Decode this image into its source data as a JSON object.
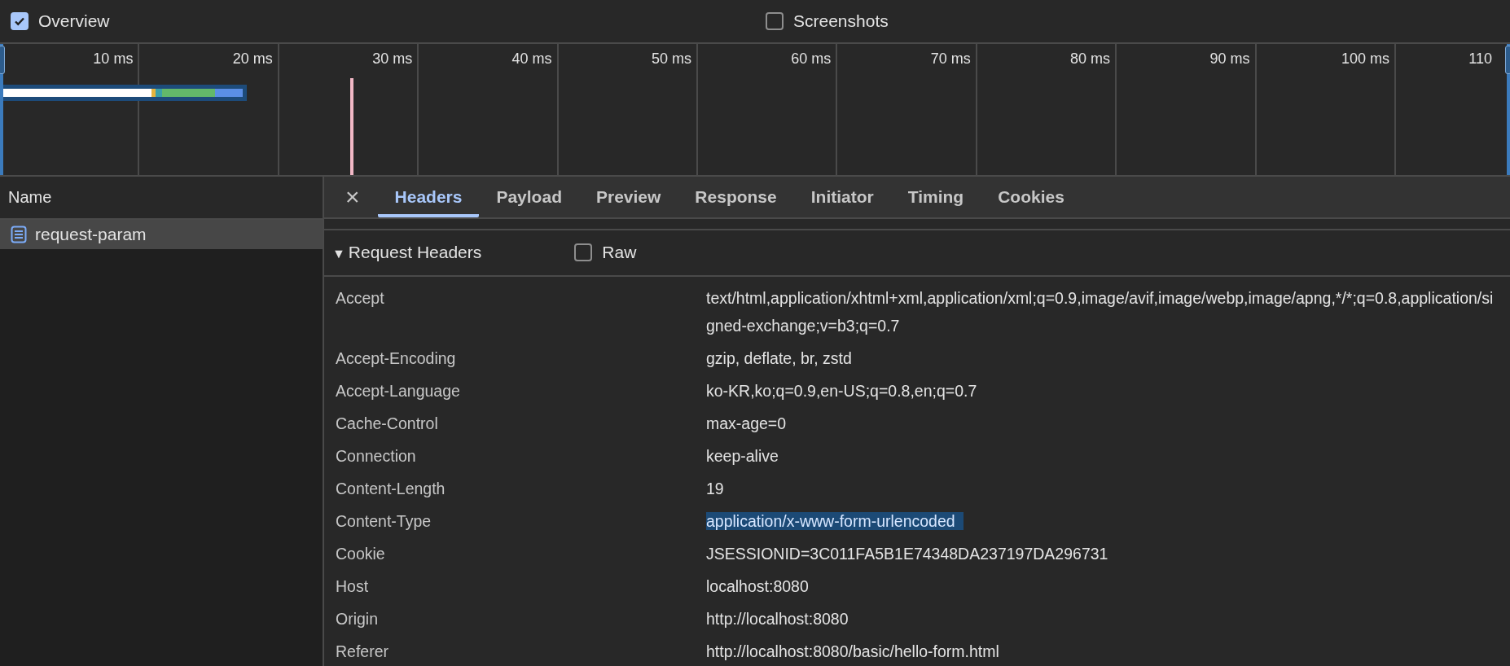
{
  "toolbar": {
    "options": [
      {
        "label": "Overview",
        "checked": true
      },
      {
        "label": "Screenshots",
        "checked": false
      }
    ]
  },
  "timeline": {
    "ticks": [
      "10 ms",
      "20 ms",
      "30 ms",
      "40 ms",
      "50 ms",
      "60 ms",
      "70 ms",
      "80 ms",
      "90 ms",
      "100 ms",
      "110"
    ]
  },
  "requests": {
    "column": "Name",
    "items": [
      {
        "name": "request-param",
        "selected": true
      }
    ]
  },
  "details": {
    "close": "×",
    "tabs": [
      {
        "label": "Headers",
        "selected": true
      },
      {
        "label": "Payload",
        "selected": false
      },
      {
        "label": "Preview",
        "selected": false
      },
      {
        "label": "Response",
        "selected": false
      },
      {
        "label": "Initiator",
        "selected": false
      },
      {
        "label": "Timing",
        "selected": false
      },
      {
        "label": "Cookies",
        "selected": false
      }
    ],
    "section": {
      "toggle": "▼",
      "title": "Request Headers",
      "expanded": true,
      "raw": {
        "label": "Raw",
        "checked": false
      }
    },
    "headers": [
      {
        "name": "Accept",
        "value": "text/html,application/xhtml+xml,application/xml;q=0.9,image/avif,image/webp,image/apng,*/*;q=0.8,application/signed-exchange;v=b3;q=0.7",
        "selected": false
      },
      {
        "name": "Accept-Encoding",
        "value": "gzip, deflate, br, zstd",
        "selected": false
      },
      {
        "name": "Accept-Language",
        "value": "ko-KR,ko;q=0.9,en-US;q=0.8,en;q=0.7",
        "selected": false
      },
      {
        "name": "Cache-Control",
        "value": "max-age=0",
        "selected": false
      },
      {
        "name": "Connection",
        "value": "keep-alive",
        "selected": false
      },
      {
        "name": "Content-Length",
        "value": "19",
        "selected": false
      },
      {
        "name": "Content-Type",
        "value": "application/x-www-form-urlencoded",
        "selected": true
      },
      {
        "name": "Cookie",
        "value": "JSESSIONID=3C011FA5B1E74348DA237197DA296731",
        "selected": false
      },
      {
        "name": "Host",
        "value": "localhost:8080",
        "selected": false
      },
      {
        "name": "Origin",
        "value": "http://localhost:8080",
        "selected": false
      },
      {
        "name": "Referer",
        "value": "http://localhost:8080/basic/hello-form.html",
        "selected": false
      }
    ]
  }
}
